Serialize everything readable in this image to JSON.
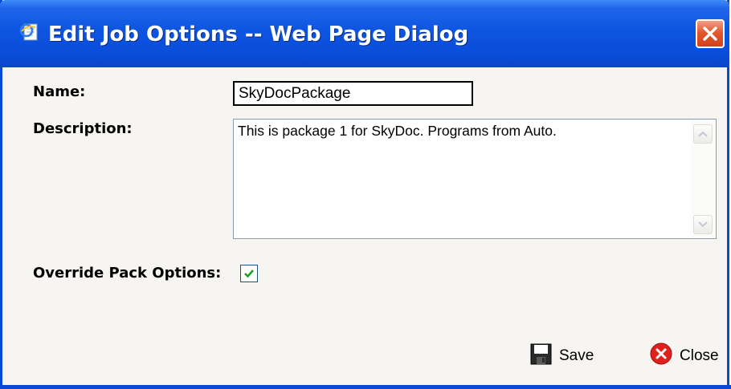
{
  "window": {
    "title": "Edit Job Options -- Web Page Dialog",
    "title_icon": "ie-page-icon",
    "close_icon": "close-x-icon"
  },
  "form": {
    "name_label": "Name:",
    "name_value": "SkyDocPackage",
    "description_label": "Description:",
    "description_value": "This is package 1 for SkyDoc. Programs from Auto.",
    "override_label": "Override Pack Options:",
    "override_checked": true
  },
  "actions": {
    "save_label": "Save",
    "save_icon": "floppy-disk-icon",
    "close_label": "Close",
    "close_icon": "red-x-circle-icon"
  },
  "colors": {
    "titlebar": "#0a4ddb",
    "body": "#f6f5f1",
    "check": "#21a121",
    "close_red": "#e0201c"
  }
}
